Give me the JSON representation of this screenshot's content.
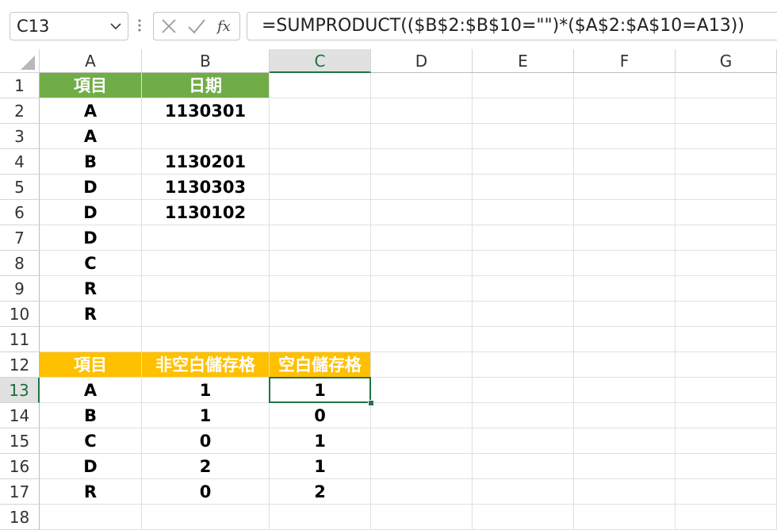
{
  "name_box": {
    "value": "C13"
  },
  "formula_bar": {
    "formula": "=SUMPRODUCT(($B$2:$B$10=\"\")*($A$2:$A$10=A13))"
  },
  "columns": [
    "A",
    "B",
    "C",
    "D",
    "E",
    "F",
    "G"
  ],
  "rows": [
    "1",
    "2",
    "3",
    "4",
    "5",
    "6",
    "7",
    "8",
    "9",
    "10",
    "11",
    "12",
    "13",
    "14",
    "15",
    "16",
    "17",
    "18"
  ],
  "selected": {
    "column": "C",
    "row": "13"
  },
  "colors": {
    "green_header": "#70ad47",
    "gold_header": "#ffc000",
    "selection": "#217346"
  },
  "table1": {
    "headers": [
      "項目",
      "日期"
    ],
    "rows": [
      [
        "A",
        "1130301"
      ],
      [
        "A",
        ""
      ],
      [
        "B",
        "1130201"
      ],
      [
        "D",
        "1130303"
      ],
      [
        "D",
        "1130102"
      ],
      [
        "D",
        ""
      ],
      [
        "C",
        ""
      ],
      [
        "R",
        ""
      ],
      [
        "R",
        ""
      ]
    ]
  },
  "table2": {
    "headers": [
      "項目",
      "非空白儲存格",
      "空白儲存格"
    ],
    "rows": [
      [
        "A",
        "1",
        "1"
      ],
      [
        "B",
        "1",
        "0"
      ],
      [
        "C",
        "0",
        "1"
      ],
      [
        "D",
        "2",
        "1"
      ],
      [
        "R",
        "0",
        "2"
      ]
    ]
  }
}
